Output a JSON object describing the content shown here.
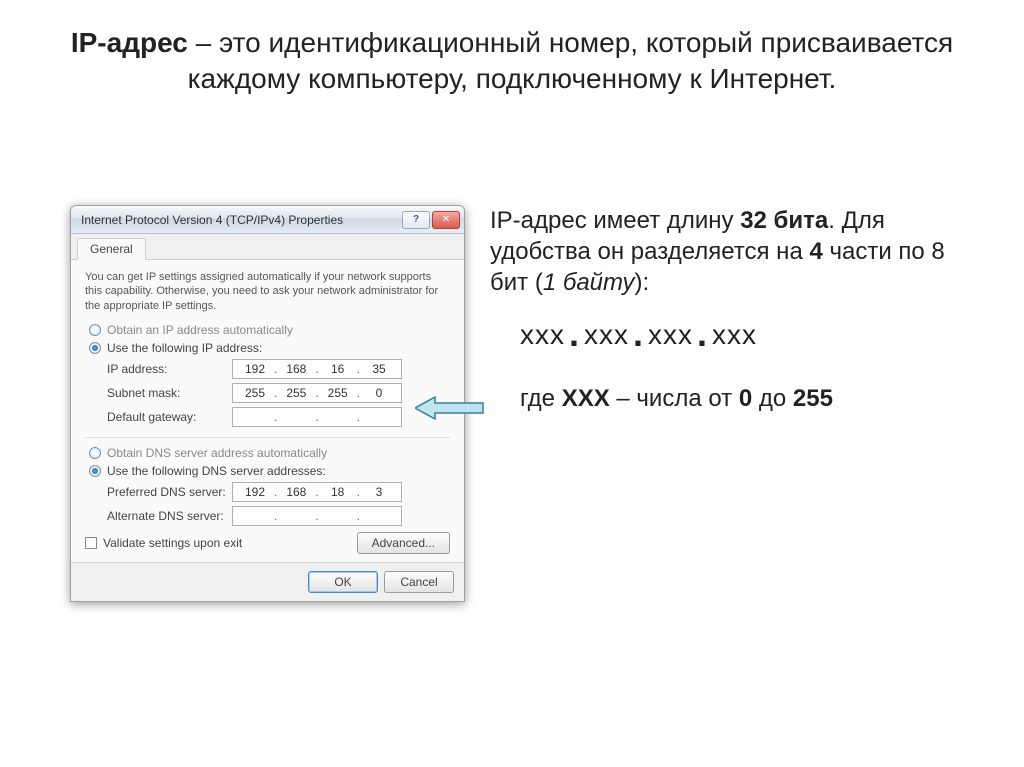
{
  "slide": {
    "title_bold": "IP-адрес",
    "title_rest": " – это идентификационный номер, который присваивается каждому компьютеру, подключенному к Интернет."
  },
  "dialog": {
    "title": "Internet Protocol Version 4 (TCP/IPv4) Properties",
    "tab": "General",
    "description": "You can get IP settings assigned automatically if your network supports this capability. Otherwise, you need to ask your network administrator for the appropriate IP settings.",
    "radio_auto_ip": "Obtain an IP address automatically",
    "radio_use_ip": "Use the following IP address:",
    "labels": {
      "ip": "IP address:",
      "mask": "Subnet mask:",
      "gw": "Default gateway:",
      "pref": "Preferred DNS server:",
      "alt": "Alternate DNS server:"
    },
    "ip": [
      "192",
      "168",
      "16",
      "35"
    ],
    "mask": [
      "255",
      "255",
      "255",
      "0"
    ],
    "gw": [
      "",
      "",
      "",
      ""
    ],
    "radio_auto_dns": "Obtain DNS server address automatically",
    "radio_use_dns": "Use the following DNS server addresses:",
    "pref_dns": [
      "192",
      "168",
      "18",
      "3"
    ],
    "alt_dns": [
      "",
      "",
      "",
      ""
    ],
    "validate": "Validate settings upon exit",
    "advanced": "Advanced...",
    "ok": "OK",
    "cancel": "Cancel"
  },
  "right": {
    "line1_a": "IP-адрес имеет длину ",
    "line1_b": "32 бита",
    "line1_c": ". Для удобства он разделяется на ",
    "line1_d": "4",
    "line1_e": " части по 8 бит (",
    "line1_f": "1 байту",
    "line1_g": "):",
    "fmt_x": "xxx",
    "where_a": "где ",
    "where_b": "XXX",
    "where_c": " – числа от ",
    "where_d": "0",
    "where_e": " до ",
    "where_f": "255"
  }
}
